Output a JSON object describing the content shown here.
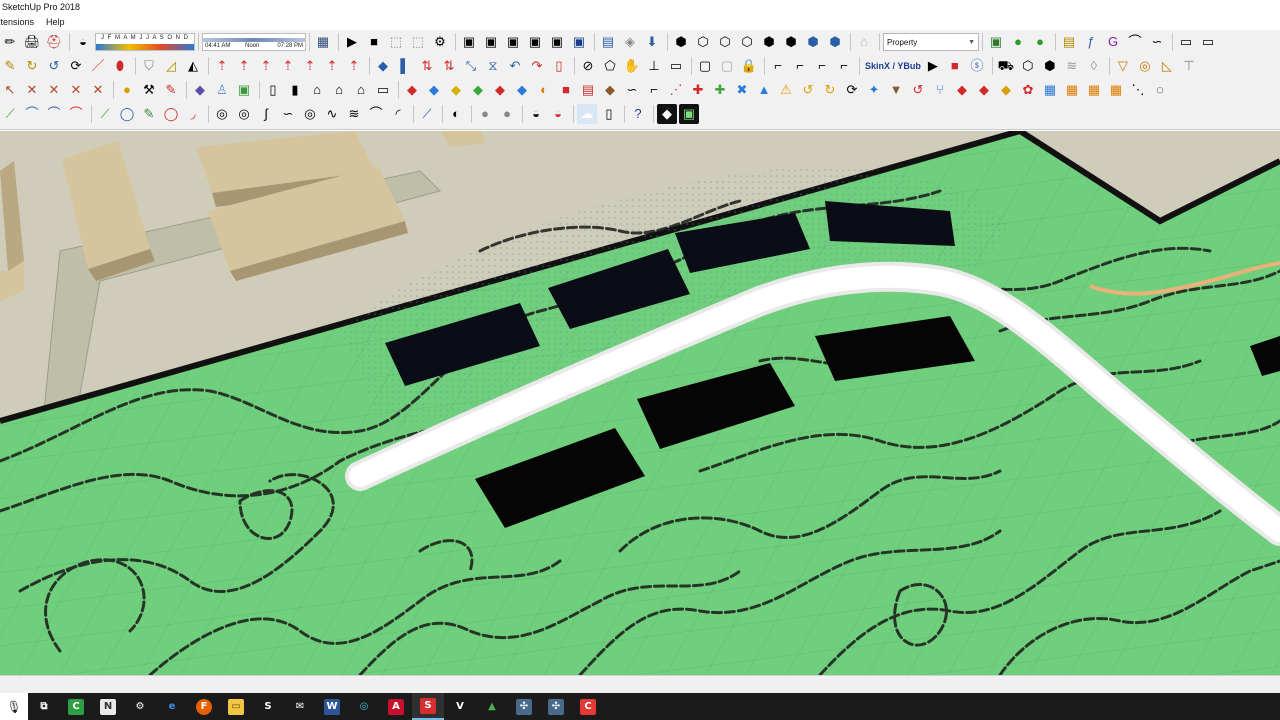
{
  "window": {
    "title": "SketchUp Pro 2018"
  },
  "menu": {
    "items": [
      "Extensions",
      "Help"
    ]
  },
  "shadow": {
    "months": "J F M A M J J A S O N D",
    "time_start": "04:41 AM",
    "time_noon": "Noon",
    "time_end": "07:28 PM"
  },
  "styles_dropdown": {
    "value": "Property"
  },
  "plugin": {
    "skinx_label": "SkinX / YBub"
  },
  "colors": {
    "terrain": "#6fcf7d",
    "road": "#ffffff",
    "buildings_dark": "#0b0d16",
    "context_ground": "#cfcdb9",
    "context_buildings": "#d6c49c",
    "path": "#e8b27a"
  },
  "toolbar_rows": [
    [
      "dropdown-select-icon",
      "paint-bucket-icon",
      "camera-icon",
      "eraser-icon"
    ],
    [
      "rotated-rectangle-icon",
      "push-pull-icon",
      "follow-me-icon",
      "offset-icon"
    ],
    [
      "select-icon",
      "component-icon",
      "layer-icon",
      "globe-icon"
    ],
    [
      "line-icon",
      "arc-icon",
      "circle-icon",
      "polygon-icon"
    ]
  ],
  "taskbar": {
    "apps": [
      {
        "name": "task-view-icon",
        "label": "⧉"
      },
      {
        "name": "camtasia-icon",
        "label": "C"
      },
      {
        "name": "notepad-icon",
        "label": "N"
      },
      {
        "name": "settings-icon",
        "label": "⚙"
      },
      {
        "name": "edge-icon",
        "label": "e"
      },
      {
        "name": "firefox-icon",
        "label": "F"
      },
      {
        "name": "file-explorer-icon",
        "label": "▭"
      },
      {
        "name": "store-icon",
        "label": "S"
      },
      {
        "name": "mail-icon",
        "label": "✉"
      },
      {
        "name": "word-icon",
        "label": "W"
      },
      {
        "name": "app-blue-icon",
        "label": "◎"
      },
      {
        "name": "autocad-icon",
        "label": "A"
      },
      {
        "name": "sketchup-icon",
        "label": "S"
      },
      {
        "name": "vray-icon",
        "label": "V"
      },
      {
        "name": "terrain-app-icon",
        "label": "▲"
      },
      {
        "name": "app-grid-icon",
        "label": "✣"
      },
      {
        "name": "app-grid2-icon",
        "label": "✣"
      },
      {
        "name": "camtasia-rec-icon",
        "label": "C"
      }
    ]
  }
}
